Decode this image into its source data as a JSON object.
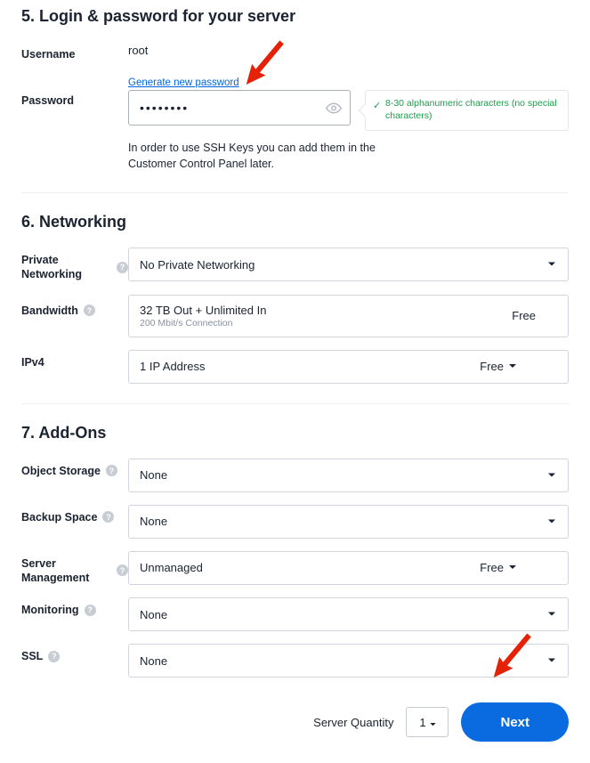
{
  "section5": {
    "title": "5. Login & password for your server",
    "username_label": "Username",
    "username_value": "root",
    "password_label": "Password",
    "generate_link": "Generate new password",
    "password_value": "••••••••",
    "validation_text": "8-30 alphanumeric characters (no special characters)",
    "ssh_note": "In order to use SSH Keys you can add them in the Customer Control Panel later."
  },
  "section6": {
    "title": "6. Networking",
    "private_networking": {
      "label": "Private Networking",
      "value": "No Private Networking"
    },
    "bandwidth": {
      "label": "Bandwidth",
      "value": "32 TB Out + Unlimited In",
      "sub": "200 Mbit/s Connection",
      "price": "Free"
    },
    "ipv4": {
      "label": "IPv4",
      "value": "1 IP Address",
      "price": "Free"
    }
  },
  "section7": {
    "title": "7. Add-Ons",
    "object_storage": {
      "label": "Object Storage",
      "value": "None"
    },
    "backup_space": {
      "label": "Backup Space",
      "value": "None"
    },
    "server_management": {
      "label": "Server Management",
      "value": "Unmanaged",
      "price": "Free"
    },
    "monitoring": {
      "label": "Monitoring",
      "value": "None"
    },
    "ssl": {
      "label": "SSL",
      "value": "None"
    }
  },
  "footer": {
    "qty_label": "Server Quantity",
    "qty_value": "1",
    "next_label": "Next"
  }
}
